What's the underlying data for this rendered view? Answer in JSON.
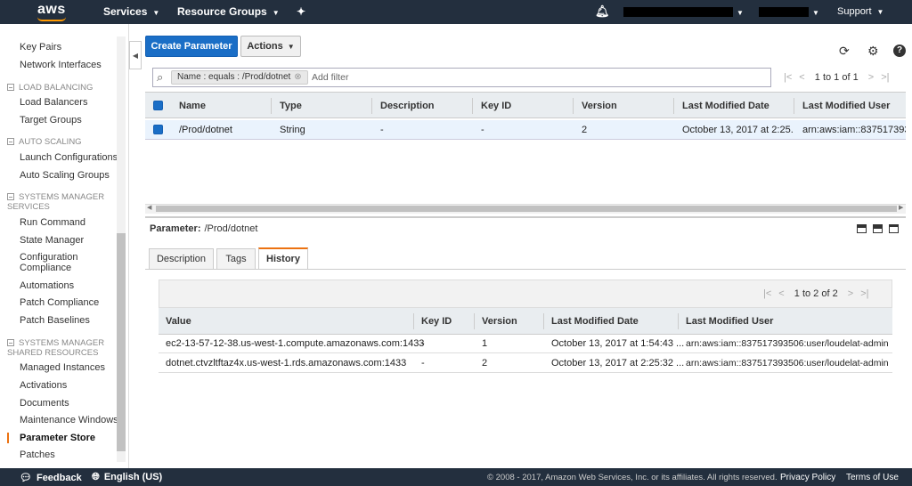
{
  "topnav": {
    "logo": "aws",
    "services": "Services",
    "resource_groups": "Resource Groups",
    "support": "Support"
  },
  "sidebar": {
    "items_top": [
      "Key Pairs",
      "Network Interfaces"
    ],
    "sections": [
      {
        "title": "LOAD BALANCING",
        "items": [
          "Load Balancers",
          "Target Groups"
        ]
      },
      {
        "title": "AUTO SCALING",
        "items": [
          "Launch Configurations",
          "Auto Scaling Groups"
        ]
      },
      {
        "title": "SYSTEMS MANAGER SERVICES",
        "items": [
          "Run Command",
          "State Manager",
          "Configuration Compliance",
          "Automations",
          "Patch Compliance",
          "Patch Baselines"
        ]
      },
      {
        "title": "SYSTEMS MANAGER SHARED RESOURCES",
        "items": [
          "Managed Instances",
          "Activations",
          "Documents",
          "Maintenance Windows",
          "Parameter Store",
          "Patches"
        ]
      }
    ],
    "active": "Parameter Store"
  },
  "toolbar": {
    "create_label": "Create Parameter",
    "actions_label": "Actions"
  },
  "filter": {
    "token": "Name : equals : /Prod/dotnet",
    "placeholder": "Add filter",
    "pager_text": "1 to 1 of 1"
  },
  "grid": {
    "columns": [
      "Name",
      "Type",
      "Description",
      "Key ID",
      "Version",
      "Last Modified Date",
      "Last Modified User"
    ],
    "rows": [
      {
        "name": "/Prod/dotnet",
        "type": "String",
        "description": "-",
        "key_id": "-",
        "version": "2",
        "modified_date": "October 13, 2017 at 2:25...",
        "modified_user": "arn:aws:iam::837517393..."
      }
    ]
  },
  "detail": {
    "label": "Parameter:",
    "value": "/Prod/dotnet",
    "tabs": [
      "Description",
      "Tags",
      "History"
    ],
    "active_tab": "History"
  },
  "history": {
    "pager_text": "1 to 2 of 2",
    "columns": [
      "Value",
      "Key ID",
      "Version",
      "Last Modified Date",
      "Last Modified User"
    ],
    "rows": [
      {
        "value": "ec2-13-57-12-38.us-west-1.compute.amazonaws.com:1433",
        "key_id": "-",
        "version": "1",
        "date": "October 13, 2017 at 1:54:43 ...",
        "user": "arn:aws:iam::837517393506:user/loudelat-admin"
      },
      {
        "value": "dotnet.ctvzltftaz4x.us-west-1.rds.amazonaws.com:1433",
        "key_id": "-",
        "version": "2",
        "date": "October 13, 2017 at 2:25:32 ...",
        "user": "arn:aws:iam::837517393506:user/loudelat-admin"
      }
    ]
  },
  "footer": {
    "feedback": "Feedback",
    "language": "English (US)",
    "copyright": "© 2008 - 2017, Amazon Web Services, Inc. or its affiliates. All rights reserved.",
    "privacy": "Privacy Policy",
    "terms": "Terms of Use"
  },
  "colors": {
    "nav_bg": "#232f3e",
    "primary": "#1a6ec6",
    "accent": "#ec7211"
  }
}
